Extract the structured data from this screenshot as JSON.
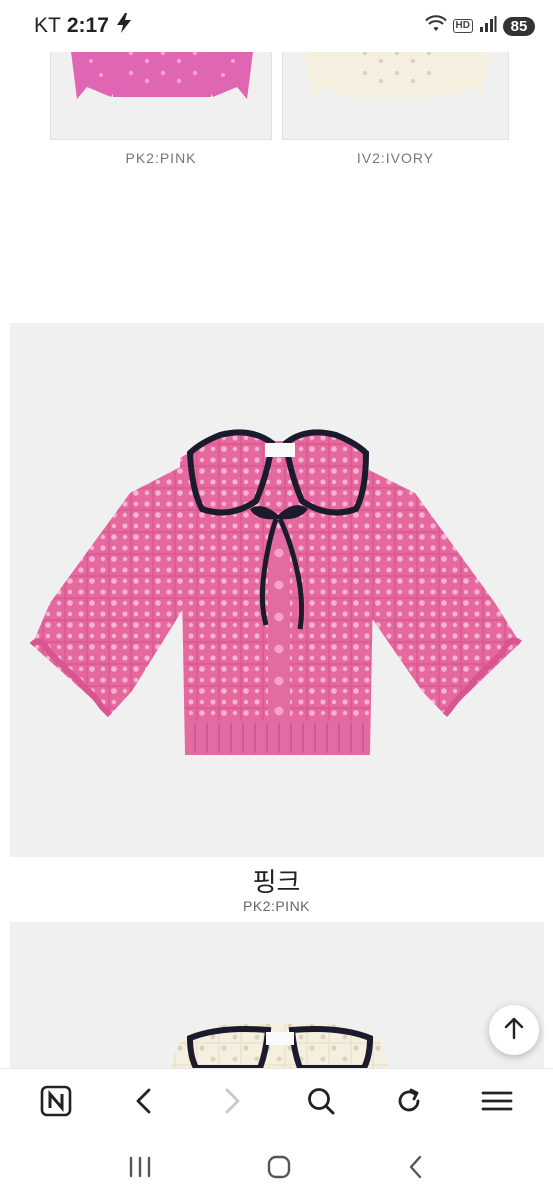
{
  "status_bar": {
    "carrier": "KT",
    "time": "2:17",
    "hd": "HD",
    "battery": "85"
  },
  "swatches": [
    {
      "label": "PK2:PINK",
      "color": "#e066b3"
    },
    {
      "label": "IV2:IVORY",
      "color": "#f3eee0"
    }
  ],
  "product": {
    "color_name_kr": "핑크",
    "color_code": "PK2:PINK",
    "main_color": "#e5689f",
    "trim_color": "#1c1b2e",
    "second_color": "#f5efe0"
  },
  "colors": {
    "image_bg": "#f0f0f0",
    "icon_dark": "#222222",
    "icon_disabled": "#c8c8c8"
  }
}
